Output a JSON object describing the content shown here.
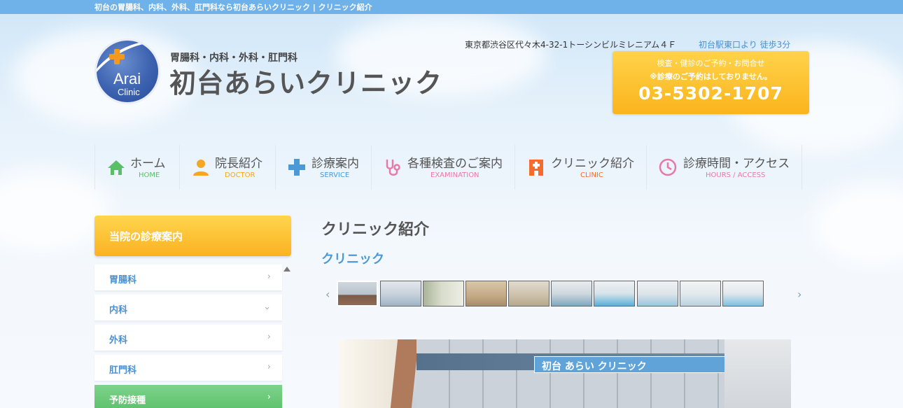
{
  "topbar": {
    "text": "初台の胃腸科、内科、外科、肛門科なら初台あらいクリニック | クリニック紹介"
  },
  "logo": {
    "line1": "Arai",
    "line2": "Clinic"
  },
  "header": {
    "subtitle": "胃腸科・内科・外科・肛門科",
    "clinic_name": "初台あらいクリニック",
    "address": "東京都渋谷区代々木4-32-1トーシンビルミレニアム４Ｆ",
    "access": "初台駅東口より 徒歩3分"
  },
  "contact": {
    "line1": "検査・健診のご予約・お問合せ",
    "line2": "※診療のご予約はしておりません。",
    "tel": "03-5302-1707"
  },
  "nav": [
    {
      "jp": "ホーム",
      "en": "HOME",
      "icon": "home-icon",
      "color": "#5bbf6a"
    },
    {
      "jp": "院長紹介",
      "en": "DOCTOR",
      "icon": "person-icon",
      "color": "#f5a623"
    },
    {
      "jp": "診療案内",
      "en": "SERVICE",
      "icon": "medical-cross-icon",
      "color": "#4a9ad8"
    },
    {
      "jp": "各種検査のご案内",
      "en": "EXAMINATION",
      "icon": "stethoscope-icon",
      "color": "#e879a6"
    },
    {
      "jp": "クリニック紹介",
      "en": "CLINIC",
      "icon": "hospital-icon",
      "color": "#f36b2e"
    },
    {
      "jp": "診療時間・アクセス",
      "en": "HOURS / ACCESS",
      "icon": "clock-icon",
      "color": "#e879a6"
    }
  ],
  "sidebar": {
    "heading": "当院の診療案内",
    "items": [
      {
        "label": "胃腸科",
        "arrow": "›"
      },
      {
        "label": "内科",
        "arrow": "⌄"
      },
      {
        "label": "外科",
        "arrow": "›"
      },
      {
        "label": "肛門科",
        "arrow": "›"
      },
      {
        "label": "予防接種",
        "arrow": "›"
      }
    ]
  },
  "main": {
    "page_title": "クリニック紹介",
    "section_title": "クリニック",
    "prev": "‹",
    "next": "›",
    "photo_sign": "初台 あらい クリニック"
  }
}
